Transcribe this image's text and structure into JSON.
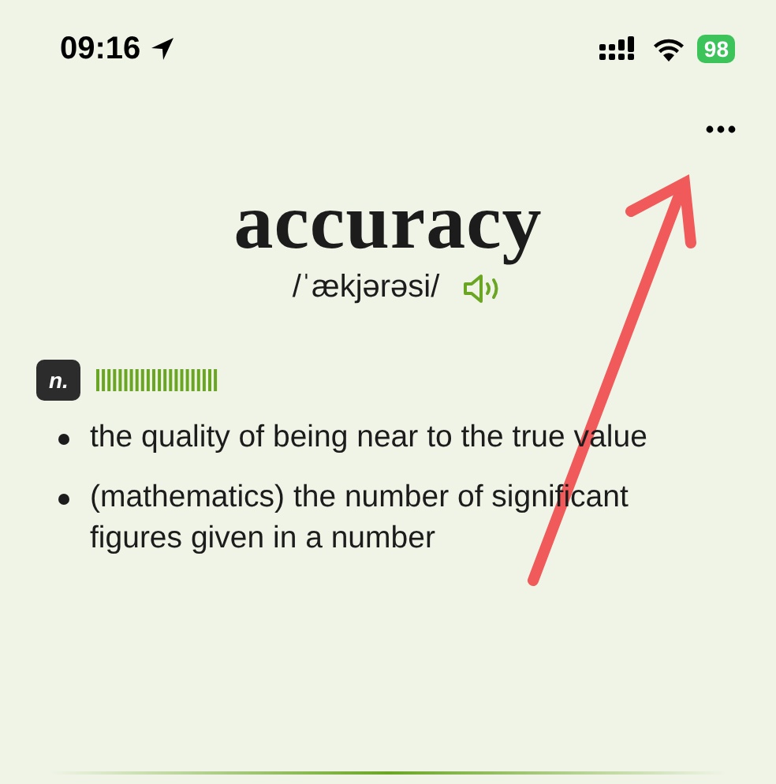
{
  "status_bar": {
    "time": "09:16",
    "battery": "98"
  },
  "entry": {
    "word": "accuracy",
    "pronunciation": "/ˈækjərəsi/"
  },
  "senses": [
    {
      "part_of_speech": "n.",
      "definitions": [
        "the quality of being near to the true value",
        "(mathematics) the number of significant figures given in a number"
      ]
    }
  ]
}
